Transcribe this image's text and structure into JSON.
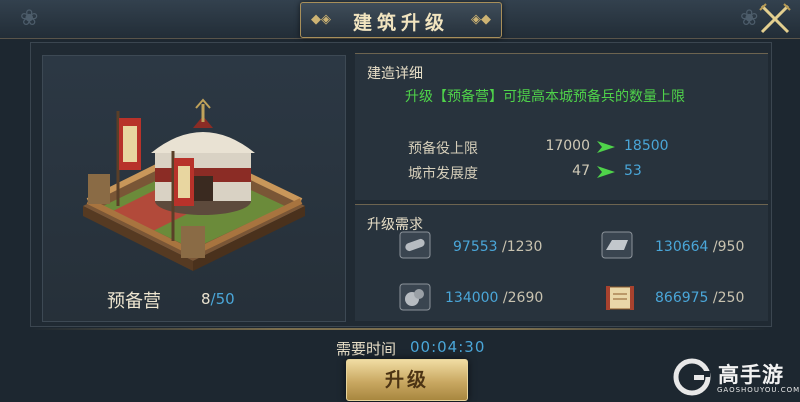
{
  "header": {
    "title": "建筑升级",
    "left_ornament": "◆◈",
    "right_ornament": "◈◆"
  },
  "building": {
    "name": "预备营",
    "count_current": "8",
    "count_separator": "/",
    "count_max": "50"
  },
  "details": {
    "section_title": "建造详细",
    "description": "升级【预备营】可提高本城预备兵的数量上限",
    "stats": [
      {
        "label": "预备役上限",
        "current": "17000",
        "next": "18500"
      },
      {
        "label": "城市发展度",
        "current": "47",
        "next": "53"
      }
    ]
  },
  "requirements": {
    "section_title": "升级需求",
    "resources": [
      {
        "icon": "wood-icon",
        "have": "97553",
        "need": "/1230"
      },
      {
        "icon": "iron-ingot-icon",
        "have": "130664",
        "need": "/950"
      },
      {
        "icon": "stone-icon",
        "have": "134000",
        "need": "/2690"
      },
      {
        "icon": "scroll-icon",
        "have": "866975",
        "need": "/250"
      }
    ]
  },
  "footer": {
    "time_label": "需要时间",
    "time_value": "00:04:30",
    "upgrade_label": "升级"
  },
  "watermark": {
    "brand": "高手游",
    "url": "GAOSHOUYOU.COM"
  },
  "colors": {
    "accent_blue": "#4aa6d8",
    "accent_green": "#4fd34a",
    "gold": "#c9a862"
  }
}
